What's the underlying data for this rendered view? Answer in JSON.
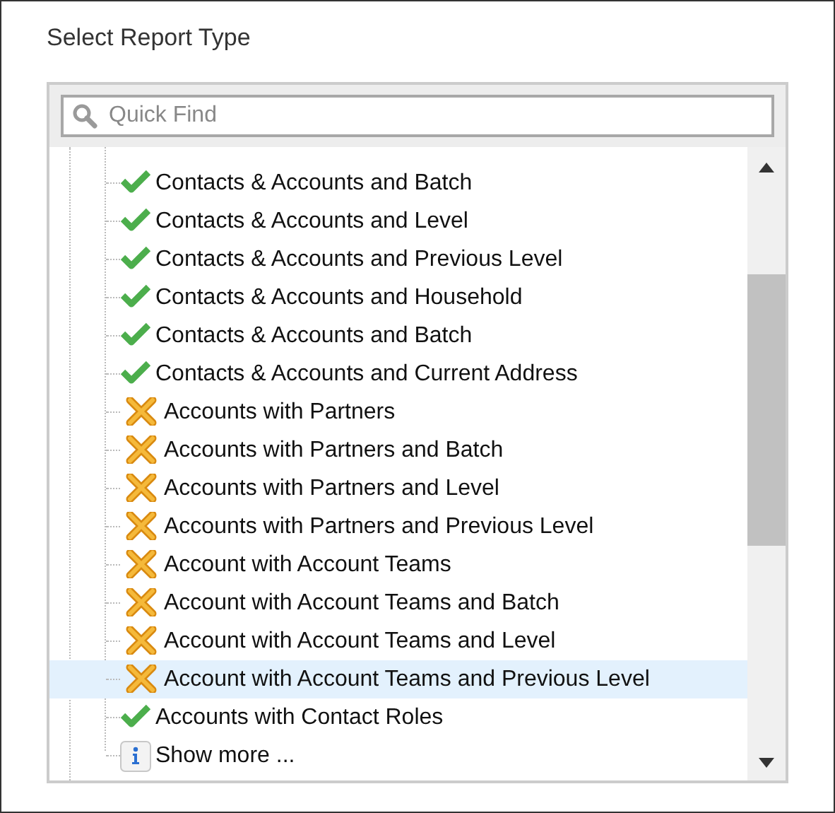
{
  "heading": "Select Report Type",
  "search": {
    "placeholder": "Quick Find"
  },
  "items": [
    {
      "label": "Contacts & Accounts and Batch",
      "kind": "check",
      "selected": false
    },
    {
      "label": "Contacts & Accounts and Level",
      "kind": "check",
      "selected": false
    },
    {
      "label": "Contacts & Accounts and Previous Level",
      "kind": "check",
      "selected": false
    },
    {
      "label": "Contacts & Accounts and Household",
      "kind": "check",
      "selected": false
    },
    {
      "label": "Contacts & Accounts and Batch",
      "kind": "check",
      "selected": false
    },
    {
      "label": "Contacts & Accounts and Current Address",
      "kind": "check",
      "selected": false
    },
    {
      "label": "Accounts with Partners",
      "kind": "cross",
      "selected": false
    },
    {
      "label": "Accounts with Partners and Batch",
      "kind": "cross",
      "selected": false
    },
    {
      "label": "Accounts with Partners and Level",
      "kind": "cross",
      "selected": false
    },
    {
      "label": "Accounts with Partners and Previous Level",
      "kind": "cross",
      "selected": false
    },
    {
      "label": "Account with Account Teams",
      "kind": "cross",
      "selected": false
    },
    {
      "label": "Account with Account Teams and Batch",
      "kind": "cross",
      "selected": false
    },
    {
      "label": "Account with Account Teams and Level",
      "kind": "cross",
      "selected": false
    },
    {
      "label": "Account with Account Teams and Previous Level",
      "kind": "cross",
      "selected": true
    },
    {
      "label": "Accounts with Contact Roles",
      "kind": "check",
      "selected": false
    },
    {
      "label": "Show more ...",
      "kind": "info",
      "selected": false
    }
  ]
}
